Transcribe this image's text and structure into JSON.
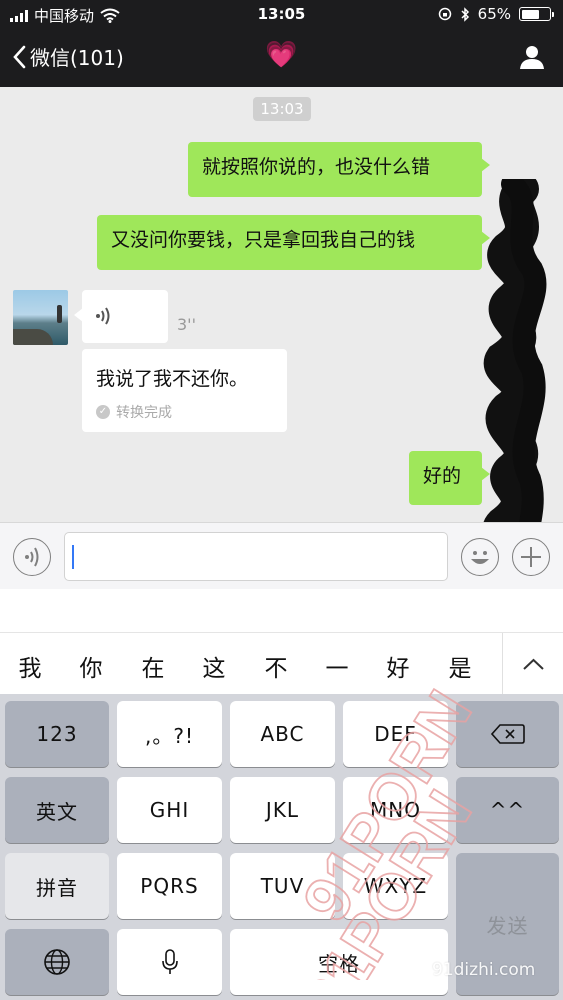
{
  "status_bar": {
    "carrier": "中国移动",
    "time": "13:05",
    "battery": "65%",
    "battery_level": 0.65,
    "icons": [
      "signal-icon",
      "wifi-icon",
      "rotation-lock-icon",
      "bluetooth-icon",
      "battery-icon"
    ]
  },
  "nav": {
    "back_label": "微信(101)",
    "title_emoji": "💗",
    "right_icon": "contact-profile-icon"
  },
  "chat": {
    "timestamp": "13:03",
    "messages": [
      {
        "side": "out",
        "text": "就按照你说的，也没什么错"
      },
      {
        "side": "out",
        "text": "又没问你要钱，只是拿回我自己的钱"
      },
      {
        "side": "in",
        "type": "voice",
        "duration": "3''"
      },
      {
        "side": "in",
        "type": "transcript",
        "text": "我说了我不还你。",
        "status": "转换完成"
      },
      {
        "side": "out",
        "text": "好的"
      }
    ]
  },
  "input_bar": {
    "value": "",
    "icons": [
      "voice-toggle-icon",
      "emoji-icon",
      "plus-icon"
    ]
  },
  "candidates": [
    "我",
    "你",
    "在",
    "这",
    "不",
    "一",
    "好",
    "是"
  ],
  "keyboard": {
    "row1": [
      "123",
      ",。?!",
      "ABC",
      "DEF"
    ],
    "row2": [
      "英文",
      "GHI",
      "JKL",
      "MNO",
      "^^"
    ],
    "row3": [
      "拼音",
      "PQRS",
      "TUV",
      "WXYZ"
    ],
    "row4": [
      "空格"
    ],
    "send": "发送",
    "icons": [
      "delete-icon",
      "globe-icon",
      "microphone-icon"
    ]
  },
  "watermark": {
    "text": "91PORN",
    "site": "91dizhi.com"
  },
  "colors": {
    "bar_bg": "#1c1c1e",
    "chat_bg": "#ebebeb",
    "outgoing_bubble": "#9fe75a",
    "incoming_bubble": "#ffffff",
    "keyboard_bg": "#d3d5db",
    "dark_key": "#abb0bb",
    "watermark": "#e8a3a3"
  }
}
